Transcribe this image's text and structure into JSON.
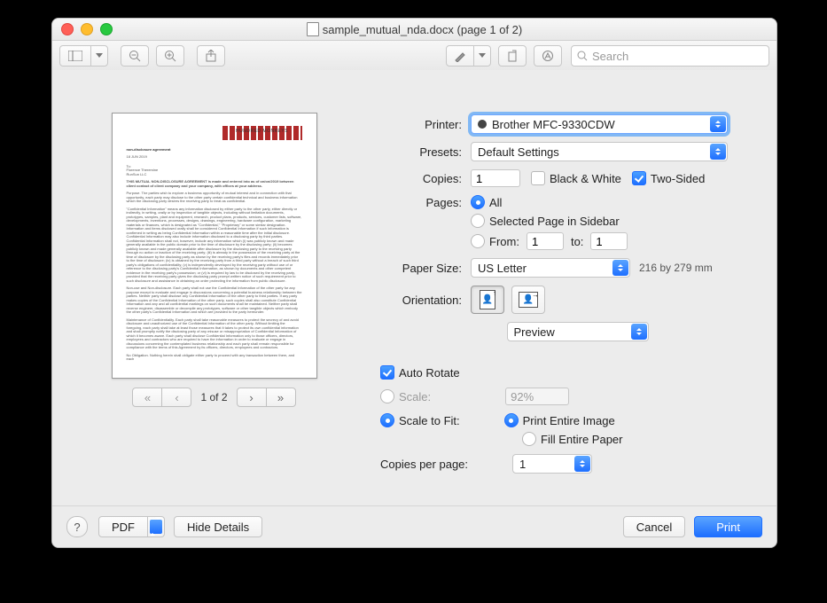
{
  "window": {
    "title": "sample_mutual_nda.docx (page 1 of 2)"
  },
  "toolbar": {
    "search_placeholder": "Search"
  },
  "preview": {
    "page_indicator": "1 of 2",
    "doc_heading1": "non-disclosure agreement",
    "doc_date": "18 JUN 2019",
    "doc_to": "To:",
    "doc_name": "Florence Theremine",
    "doc_company": "RunSun LLC",
    "doc_title": "THIS MUTUAL NON-DISCLOSURE AGREEMENT is made and entered into as of on/on/2019 between client contact of client company and your company, with offices at your address.",
    "doc_p1": "Purpose. The parties wish to explore a business opportunity of mutual interest and in connection with that opportunity, each party may disclose to the other party certain confidential technical and business information which the disclosing party desires the receiving party to treat as confidential.",
    "doc_p2": "\"Confidential Information\" means any information disclosed by either party to the other party, either directly or indirectly, in writing, orally or by inspection of tangible objects, including without limitation documents, prototypes, samples, plant and equipment, research, product plans, products, services, customer lists, software, developments, inventions, processes, designs, drawings, engineering, hardware configuration, marketing materials or finances, which is designated as \"Confidential,\" \"Proprietary\" or some similar designation. Information and items disclosed orally shall be considered Confidential Information if such information is confirmed in writing as being Confidential Information within a reasonable time after the initial disclosure. Confidential Information may also include information disclosed to a disclosing party by third parties. Confidential Information shall not, however, include any information which (i) was publicly known and made generally available in the public domain prior to the time of disclosure by the disclosing party; (ii) becomes publicly known and made generally available after disclosure by the disclosing party to the receiving party through no action or inaction of the receiving party; (iii) is already in the possession of the receiving party at the time of disclosure by the disclosing party as shown by the receiving party's files and records immediately prior to the time of disclosure; (iv) is obtained by the receiving party from a third party without a breach of such third party's obligations of confidentiality; (v) is independently developed by the receiving party without use of or reference to the disclosing party's Confidential Information, as shown by documents and other competent evidence in the receiving party's possession; or (vi) is required by law to be disclosed by the receiving party, provided that the receiving party gives the disclosing party prompt written notice of such requirement prior to such disclosure and assistance in obtaining an order protecting the information from public disclosure.",
    "doc_p3": "Non-use and Non-disclosure. Each party shall not use the Confidential Information of the other party for any purpose except to evaluate and engage in discussions concerning a potential business relationship between the parties. Neither party shall disclose any Confidential Information of the other party to third parties. If any party makes copies of the Confidential Information of the other party, such copies shall also constitute Confidential Information and any and all confidential markings on such documents shall be maintained. Neither party shall reverse engineer, disassemble or decompile any prototypes, software or other tangible objects which embody the other party's Confidential Information and which are provided to the party hereunder.",
    "doc_p4": "Maintenance of Confidentiality. Each party shall take reasonable measures to protect the secrecy of and avoid disclosure and unauthorized use of the Confidential Information of the other party. Without limiting the foregoing, each party shall take at least those measures that it takes to protect its own confidential information and shall promptly notify the disclosing party of any misuse or misappropriation of Confidential Information of which it becomes aware. Each party shall disclose Confidential Information only to those officers, directors, employees and contractors who are required to have the information in order to evaluate or engage in discussions concerning the contemplated business relationship and each party shall remain responsible for compliance with the terms of this Agreement by its officers, directors, employees and contractors.",
    "doc_p5": "No Obligation. Nothing herein shall obligate either party to proceed with any transaction between them, and each"
  },
  "form": {
    "labels": {
      "printer": "Printer:",
      "presets": "Presets:",
      "copies": "Copies:",
      "pages": "Pages:",
      "paper_size": "Paper Size:",
      "orientation": "Orientation:",
      "copies_per_page": "Copies per page:"
    },
    "printer_value": "Brother MFC-9330CDW",
    "presets_value": "Default Settings",
    "copies_value": "1",
    "bw_label": "Black & White",
    "twosided_label": "Two-Sided",
    "pages_all": "All",
    "pages_selected": "Selected Page in Sidebar",
    "pages_from": "From:",
    "pages_to": "to:",
    "from_value": "1",
    "to_value": "1",
    "paper_size_value": "US Letter",
    "paper_size_hint": "216 by 279 mm",
    "section_value": "Preview",
    "auto_rotate": "Auto Rotate",
    "scale_label": "Scale:",
    "scale_value": "92%",
    "scale_fit": "Scale to Fit:",
    "fit_entire_image": "Print Entire Image",
    "fit_entire_paper": "Fill Entire Paper",
    "copies_per_page_value": "1"
  },
  "footer": {
    "pdf": "PDF",
    "hide_details": "Hide Details",
    "cancel": "Cancel",
    "print": "Print"
  }
}
